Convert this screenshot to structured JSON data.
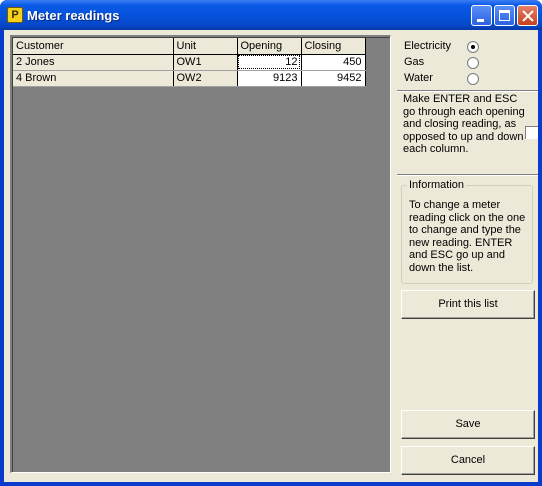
{
  "window": {
    "title": "Meter readings",
    "app_icon_letter": "P"
  },
  "grid": {
    "columns": [
      "Customer",
      "Unit",
      "Opening",
      "Closing"
    ],
    "rows": [
      {
        "customer": "2 Jones",
        "unit": "OW1",
        "opening": "12",
        "closing": "450"
      },
      {
        "customer": "4 Brown",
        "unit": "OW2",
        "opening": "9123",
        "closing": "9452"
      }
    ]
  },
  "utility": {
    "options": [
      {
        "label": "Electricity",
        "selected": true
      },
      {
        "label": "Gas",
        "selected": false
      },
      {
        "label": "Water",
        "selected": false
      }
    ]
  },
  "enter_esc_option": {
    "text": "Make ENTER and ESC go through each opening and closing reading, as opposed to up and down each column.",
    "checked": false
  },
  "information": {
    "legend": "Information",
    "text": "To change a meter reading click on the one to change and type the new reading.  ENTER and ESC go up and down the list."
  },
  "buttons": {
    "print": "Print this list",
    "save": "Save",
    "cancel": "Cancel"
  }
}
